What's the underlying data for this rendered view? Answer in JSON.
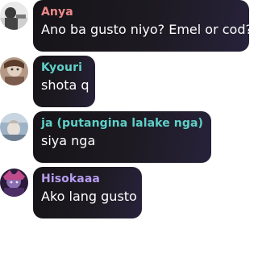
{
  "messages": [
    {
      "name": "Anya",
      "name_color": "#f08a8a",
      "text": "Ano ba gusto niyo? Emel or cod?",
      "avatar": "anya-avatar"
    },
    {
      "name": "Kyouri",
      "name_color": "#5fd0c8",
      "text": "shota q",
      "avatar": "kyouri-avatar"
    },
    {
      "name": "ja (putangina lalake nga)",
      "name_color": "#5fd0c8",
      "text": "siya nga",
      "avatar": "ja-avatar"
    },
    {
      "name": "Hisokaaa",
      "name_color": "#b79cf0",
      "text": "Ako lang gusto",
      "avatar": "hisokaaa-avatar"
    }
  ]
}
